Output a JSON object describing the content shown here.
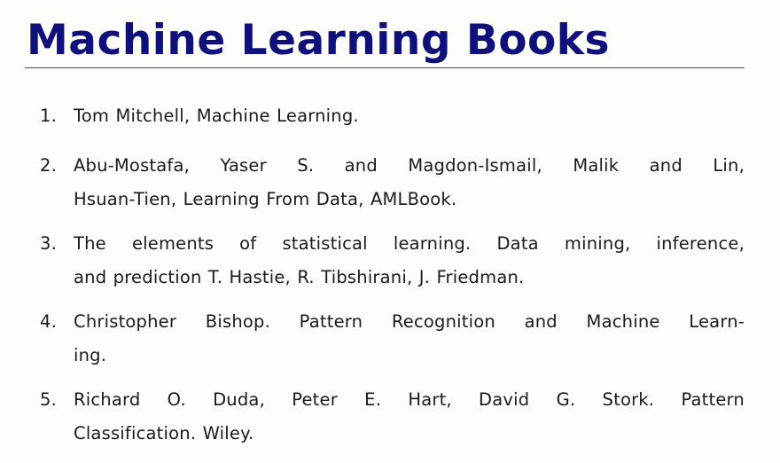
{
  "slide": {
    "title": "Machine Learning Books",
    "books": [
      {
        "number": "1.",
        "lines": [
          "Tom Mitchell, Machine Learning."
        ]
      },
      {
        "number": "2.",
        "lines": [
          "Abu-Mostafa, Yaser S. and Magdon-Ismail, Malik and Lin,",
          "Hsuan-Tien, Learning From Data, AMLBook."
        ]
      },
      {
        "number": "3.",
        "lines": [
          "The elements of statistical learning.  Data mining, inference,",
          "and prediction T. Hastie, R. Tibshirani, J. Friedman."
        ]
      },
      {
        "number": "4.",
        "lines": [
          "Christopher Bishop.  Pattern Recognition and Machine Learn-",
          "ing."
        ]
      },
      {
        "number": "5.",
        "lines": [
          "Richard O. Duda, Peter E. Hart, David G. Stork.  Pattern",
          "Classification. Wiley."
        ]
      }
    ]
  },
  "colors": {
    "title": "#10107a",
    "text": "#1a1a1a",
    "background": "#fdfdfb",
    "rule": "#4a4a4a"
  }
}
